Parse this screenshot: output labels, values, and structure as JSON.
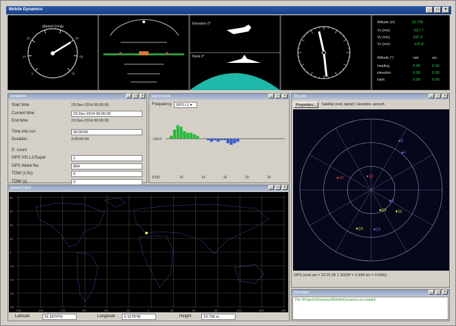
{
  "window": {
    "title": "Mobile Dynamics"
  },
  "instruments": {
    "speed_title": "Speed (m/s)",
    "speed_ticks": [
      "0",
      "10",
      "20",
      "30",
      "40",
      "50",
      "60",
      "70"
    ],
    "elevation_label": "Elevation 0°",
    "bank_label": "Bank 0°",
    "alt_label": "Altitude (m)",
    "alt_value": "19.709",
    "vel_rows": [
      {
        "label": "Vx (m/s)",
        "value": "-227.7"
      },
      {
        "label": "Vy (m/s)",
        "value": "192.3"
      },
      {
        "label": "Vz (m/s)",
        "value": "-125.8"
      }
    ],
    "att_header": "Attitude (°)",
    "att_cols": [
      "rate",
      "acc"
    ],
    "att_rows": [
      {
        "label": "heading",
        "rate": "0.00",
        "acc": "0.00"
      },
      {
        "label": "elevation",
        "rate": "0.00",
        "acc": "0.00"
      },
      {
        "label": "bank",
        "rate": "0.00",
        "acc": "0.00"
      }
    ]
  },
  "sim_panel": {
    "title": "Simulation",
    "rows": [
      {
        "label": "Start time",
        "value": "23-Dec-2014 00:00:00",
        "kind": "ro"
      },
      {
        "label": "Current time",
        "value": "23-Dec-2014 00:00:00",
        "kind": "field"
      },
      {
        "label": "End time",
        "value": "23-Dec-2014 00:00:00",
        "kind": "ro"
      },
      {
        "label": "Time into run",
        "value": "00:00:00",
        "kind": "field"
      },
      {
        "label": "Duration",
        "value": "2:00:00:00",
        "kind": "ro"
      },
      {
        "label": "E: count",
        "value": "",
        "kind": "ro"
      },
      {
        "label": "GPS VIS L1/Super",
        "value": "1",
        "kind": "field"
      },
      {
        "label": "GPS Week No.",
        "value": "804",
        "kind": "field"
      },
      {
        "label": "TOW (1.5s)",
        "value": "0",
        "kind": "field"
      },
      {
        "label": "TOW (s)",
        "value": "0",
        "kind": "field"
      }
    ]
  },
  "signal_panel": {
    "title": "Signal levels",
    "frequency_label": "Frequency",
    "frequency_value": "GPS L1",
    "axis_label": "-130.0",
    "svid_label": "SVID",
    "svid_ticks": [
      "10",
      "14",
      "16",
      "20",
      "24"
    ],
    "bars_above": [
      2,
      6,
      9,
      8,
      5,
      4,
      4,
      3,
      2
    ],
    "bars_below": [
      1,
      2,
      1,
      2,
      1,
      1,
      3,
      4,
      3,
      2
    ]
  },
  "sky_panel": {
    "title": "Sky plot",
    "button_label": "Properties...",
    "hint": "Satellite (svid, signal) / elevation, azimuth",
    "status": "GPS (svid set = 23 25 28 1 SD(0P = 0.998 elv = 0.500))",
    "satellites": [
      {
        "id": "20",
        "az": 290,
        "el": 45,
        "color": "#d84040"
      },
      {
        "id": "13",
        "az": 345,
        "el": 72,
        "color": "#d84040"
      },
      {
        "id": "7",
        "az": 40,
        "el": 28,
        "color": "#7070d8"
      },
      {
        "id": "5",
        "az": 30,
        "el": 18,
        "color": "#7070d8"
      },
      {
        "id": "11",
        "az": 130,
        "el": 48,
        "color": "#d8d840"
      },
      {
        "id": "19",
        "az": 155,
        "el": 62,
        "color": "#d8d840"
      },
      {
        "id": "24",
        "az": 200,
        "el": 38,
        "color": "#d8d840"
      },
      {
        "id": "16",
        "az": 175,
        "el": 40,
        "color": "#7070d8"
      },
      {
        "id": "8",
        "az": 120,
        "el": 62,
        "color": "#7070d8"
      }
    ]
  },
  "map_panel": {
    "title": "Ground Track",
    "lat_ticks": [
      "80",
      "60",
      "40",
      "20",
      "0",
      "-20",
      "-40",
      "-60",
      "-80"
    ],
    "lon_ticks": [
      "-180",
      "-150",
      "-120",
      "-90",
      "-60",
      "-30",
      "0",
      "30",
      "60",
      "90",
      "120",
      "150",
      "180"
    ],
    "latitude_label": "Latitude",
    "latitude_value": "51.5074°N",
    "longitude_label": "Longitude",
    "longitude_value": "0.1278°W",
    "height_label": "Height",
    "height_value": "19.709 m"
  },
  "message_panel": {
    "title": "Messages",
    "text": "File \\Projects\\Scenarios\\Mobile\\Dynamics.scn loaded"
  }
}
